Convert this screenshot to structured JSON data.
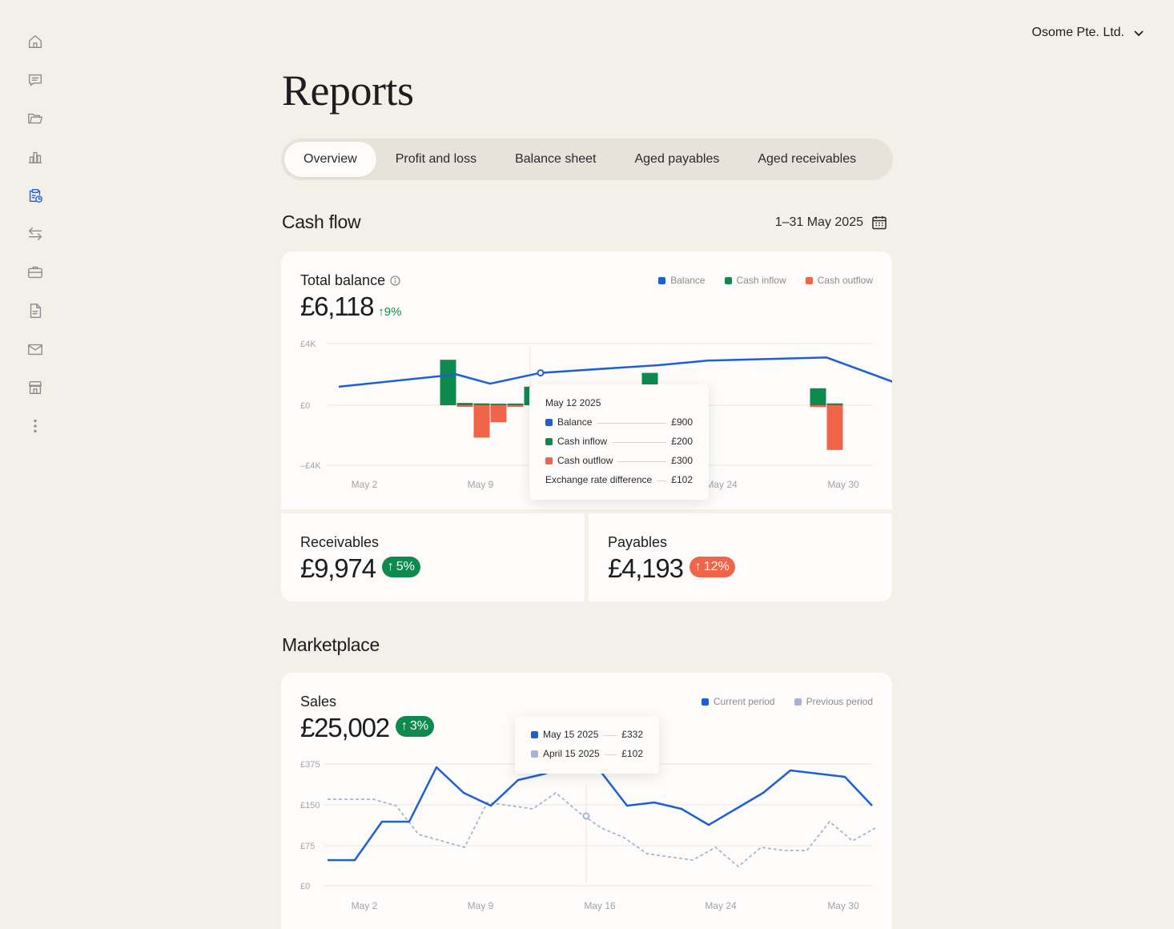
{
  "org": {
    "name": "Osome Pte. Ltd."
  },
  "page": {
    "title": "Reports"
  },
  "sidebar": {
    "items": [
      {
        "icon": "home-icon"
      },
      {
        "icon": "chat-icon"
      },
      {
        "icon": "folder-icon"
      },
      {
        "icon": "bar-chart-icon"
      },
      {
        "icon": "reports-clipboard-icon",
        "active": true
      },
      {
        "icon": "transfer-arrows-icon"
      },
      {
        "icon": "briefcase-icon"
      },
      {
        "icon": "document-icon"
      },
      {
        "icon": "mail-icon"
      },
      {
        "icon": "store-icon"
      },
      {
        "icon": "more-vertical-icon"
      }
    ]
  },
  "tabs": [
    {
      "label": "Overview",
      "active": true
    },
    {
      "label": "Profit and loss"
    },
    {
      "label": "Balance sheet"
    },
    {
      "label": "Aged payables"
    },
    {
      "label": "Aged receivables"
    }
  ],
  "cashflow": {
    "section_title": "Cash flow",
    "date_range": "1–31 May 2025",
    "total_balance": {
      "label": "Total balance",
      "value": "£6,118",
      "change": "9%"
    },
    "legend": [
      "Balance",
      "Cash inflow",
      "Cash outflow"
    ],
    "tooltip": {
      "date": "May 12 2025",
      "rows": [
        {
          "label": "Balance",
          "value": "£900"
        },
        {
          "label": "Cash inflow",
          "value": "£200"
        },
        {
          "label": "Cash outflow",
          "value": "£300"
        },
        {
          "label": "Exchange rate difference",
          "value": "£102"
        }
      ]
    }
  },
  "receivables": {
    "label": "Receivables",
    "value": "£9,974",
    "change": "5%"
  },
  "payables": {
    "label": "Payables",
    "value": "£4,193",
    "change": "12%"
  },
  "marketplace": {
    "section_title": "Marketplace",
    "sales": {
      "label": "Sales",
      "value": "£25,002",
      "change": "3%"
    },
    "legend": [
      "Current period",
      "Previous period"
    ],
    "tooltip": {
      "rows": [
        {
          "label": "May 15 2025",
          "value": "£332"
        },
        {
          "label": "April 15 2025",
          "value": "£102"
        }
      ]
    }
  },
  "colors": {
    "balance": "#1f5fd6",
    "inflow": "#0e8a4f",
    "outflow": "#f0654a",
    "previous": "#a9b4d4",
    "grid": "#e9e6e1",
    "axis_text": "#a3a3a8"
  },
  "chart_data": [
    {
      "type": "bar",
      "x_ticks": [
        "May 2",
        "May 9",
        "May 24",
        "May 30"
      ],
      "y_ticks": [
        "£4K",
        "£0",
        "–£4K"
      ],
      "ylim": [
        -4000,
        4000
      ],
      "days": [
        1,
        2,
        3,
        4,
        5,
        6,
        7,
        8,
        9,
        10,
        11,
        12,
        13,
        14,
        15,
        16,
        17,
        18,
        19,
        20,
        21,
        22,
        23,
        24,
        25,
        26,
        27,
        28,
        29,
        30,
        31
      ],
      "series": [
        {
          "name": "Balance",
          "type": "line",
          "points": [
            [
              1,
              1200
            ],
            [
              8,
              2000
            ],
            [
              10,
              1400
            ],
            [
              13,
              2100
            ],
            [
              20,
              2600
            ],
            [
              23,
              2900
            ],
            [
              30,
              3100
            ],
            [
              34,
              1500
            ]
          ]
        },
        {
          "name": "Cash inflow",
          "type": "bar",
          "points": [
            [
              7,
              2950
            ],
            [
              8,
              150
            ],
            [
              9,
              120
            ],
            [
              10,
              100
            ],
            [
              11,
              110
            ],
            [
              12,
              1200
            ],
            [
              19,
              2100
            ],
            [
              29,
              1100
            ],
            [
              30,
              120
            ]
          ]
        },
        {
          "name": "Cash outflow",
          "type": "bar",
          "points": [
            [
              8,
              -100
            ],
            [
              9,
              -2100
            ],
            [
              10,
              -1100
            ],
            [
              11,
              -100
            ],
            [
              29,
              -120
            ],
            [
              30,
              -2900
            ]
          ]
        }
      ],
      "highlight": {
        "x": 13,
        "y": 2100
      }
    },
    {
      "type": "line",
      "x_ticks": [
        "May 2",
        "May 9",
        "May 16",
        "May 24",
        "May 30"
      ],
      "y_ticks": [
        "£375",
        "£150",
        "£75",
        "£0"
      ],
      "series": [
        {
          "name": "Current period",
          "points": [
            [
              0,
              40
            ],
            [
              1,
              40
            ],
            [
              2,
              100
            ],
            [
              3,
              100
            ],
            [
              4,
              185
            ],
            [
              5,
              145
            ],
            [
              6,
              125
            ],
            [
              7,
              165
            ],
            [
              8,
              175
            ],
            [
              9,
              195
            ],
            [
              10,
              180
            ],
            [
              11,
              125
            ],
            [
              12,
              130
            ],
            [
              13,
              120
            ],
            [
              14,
              95
            ],
            [
              15,
              120
            ],
            [
              16,
              145
            ],
            [
              17,
              180
            ],
            [
              18,
              175
            ],
            [
              19,
              170
            ],
            [
              20,
              125
            ]
          ]
        },
        {
          "name": "Previous period",
          "points": [
            [
              0,
              135
            ],
            [
              1,
              135
            ],
            [
              2,
              135
            ],
            [
              3,
              125
            ],
            [
              4,
              80
            ],
            [
              5,
              70
            ],
            [
              6,
              60
            ],
            [
              7,
              130
            ],
            [
              8,
              125
            ],
            [
              9,
              120
            ],
            [
              10,
              145
            ],
            [
              11,
              115
            ],
            [
              12,
              90
            ],
            [
              13,
              75
            ],
            [
              14,
              50
            ],
            [
              15,
              45
            ],
            [
              16,
              40
            ],
            [
              17,
              60
            ],
            [
              18,
              30
            ],
            [
              19,
              60
            ],
            [
              20,
              55
            ],
            [
              21,
              55
            ],
            [
              22,
              100
            ],
            [
              23,
              70
            ],
            [
              24,
              90
            ]
          ]
        }
      ],
      "highlight": {
        "x": 10,
        "current": 195,
        "previous": 115
      }
    }
  ]
}
